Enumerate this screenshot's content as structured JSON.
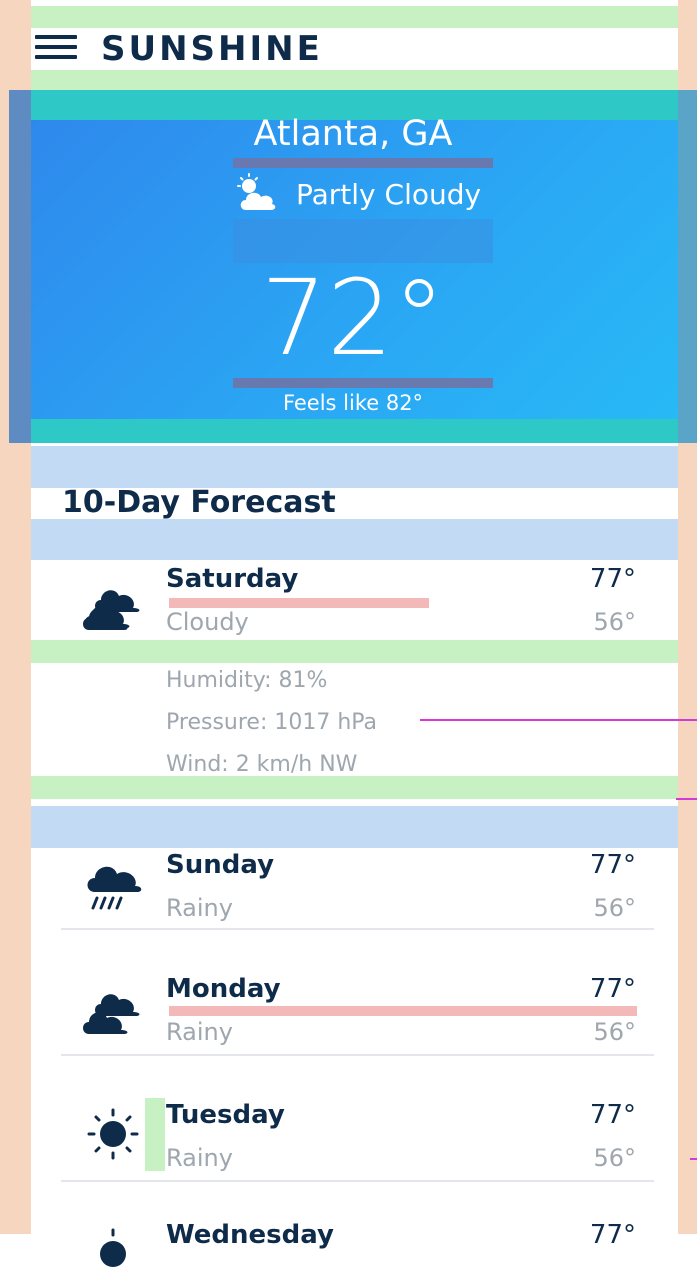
{
  "header": {
    "brand": "SUNSHINE",
    "menu_icon": "hamburger-menu-icon"
  },
  "current": {
    "city": "Atlanta, GA",
    "condition": "Partly Cloudy",
    "condition_icon": "partly-cloudy-icon",
    "temperature": "72°",
    "feels_like": "Feels like 82°"
  },
  "forecast": {
    "title": "10-Day Forecast",
    "expanded_details": {
      "humidity": "Humidity: 81%",
      "pressure": "Pressure: 1017 hPa",
      "wind": "Wind: 2 km/h NW"
    },
    "days": [
      {
        "name": "Saturday",
        "condition": "Cloudy",
        "high": "77°",
        "low": "56°",
        "icon": "cloudy-icon"
      },
      {
        "name": "Sunday",
        "condition": "Rainy",
        "high": "77°",
        "low": "56°",
        "icon": "rain-icon"
      },
      {
        "name": "Monday",
        "condition": "Rainy",
        "high": "77°",
        "low": "56°",
        "icon": "cloudy-icon"
      },
      {
        "name": "Tuesday",
        "condition": "Rainy",
        "high": "77°",
        "low": "56°",
        "icon": "sun-icon"
      },
      {
        "name": "Wednesday",
        "condition": "",
        "high": "77°",
        "low": "",
        "icon": "sun-icon"
      }
    ]
  },
  "colors": {
    "primary_dark": "#0e2b4a",
    "hero_start": "#2f86ec",
    "hero_end": "#28bbf6",
    "muted_text": "#9ea6ae"
  }
}
